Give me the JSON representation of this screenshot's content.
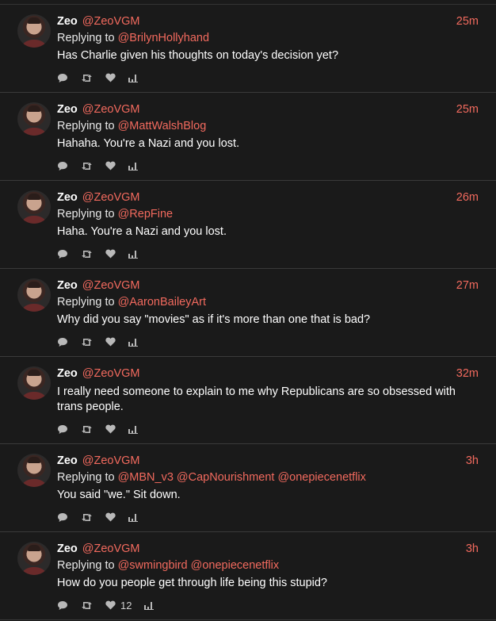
{
  "colors": {
    "background": "#1a1a1a",
    "accent": "#f26a5e",
    "icon": "#b9b9b9"
  },
  "tweets": [
    {
      "name": "Zeo",
      "handle": "@ZeoVGM",
      "time": "25m",
      "replying_label": "Replying to",
      "mentions": [
        "@BrilynHollyhand"
      ],
      "text": "Has Charlie given his thoughts on today's decision yet?",
      "likes": ""
    },
    {
      "name": "Zeo",
      "handle": "@ZeoVGM",
      "time": "25m",
      "replying_label": "Replying to",
      "mentions": [
        "@MattWalshBlog"
      ],
      "text": "Hahaha. You're a Nazi and you lost.",
      "likes": ""
    },
    {
      "name": "Zeo",
      "handle": "@ZeoVGM",
      "time": "26m",
      "replying_label": "Replying to",
      "mentions": [
        "@RepFine"
      ],
      "text": "Haha. You're a Nazi and you lost.",
      "likes": ""
    },
    {
      "name": "Zeo",
      "handle": "@ZeoVGM",
      "time": "27m",
      "replying_label": "Replying to",
      "mentions": [
        "@AaronBaileyArt"
      ],
      "text": "Why did you say \"movies\" as if it's more than one that is bad?",
      "likes": ""
    },
    {
      "name": "Zeo",
      "handle": "@ZeoVGM",
      "time": "32m",
      "replying_label": "",
      "mentions": [],
      "text": "I really need someone to explain to me why Republicans are so obsessed with trans people.",
      "likes": ""
    },
    {
      "name": "Zeo",
      "handle": "@ZeoVGM",
      "time": "3h",
      "replying_label": "Replying to",
      "mentions": [
        "@MBN_v3",
        "@CapNourishment",
        "@onepiecenetflix"
      ],
      "text": "You said \"we.\" Sit down.",
      "likes": ""
    },
    {
      "name": "Zeo",
      "handle": "@ZeoVGM",
      "time": "3h",
      "replying_label": "Replying to",
      "mentions": [
        "@swmingbird",
        "@onepiecenetflix"
      ],
      "text": "How do you people get through life being this stupid?",
      "likes": "12"
    }
  ],
  "icons": {
    "reply": "reply-icon",
    "retweet": "retweet-icon",
    "like": "heart-icon",
    "stats": "stats-icon"
  }
}
